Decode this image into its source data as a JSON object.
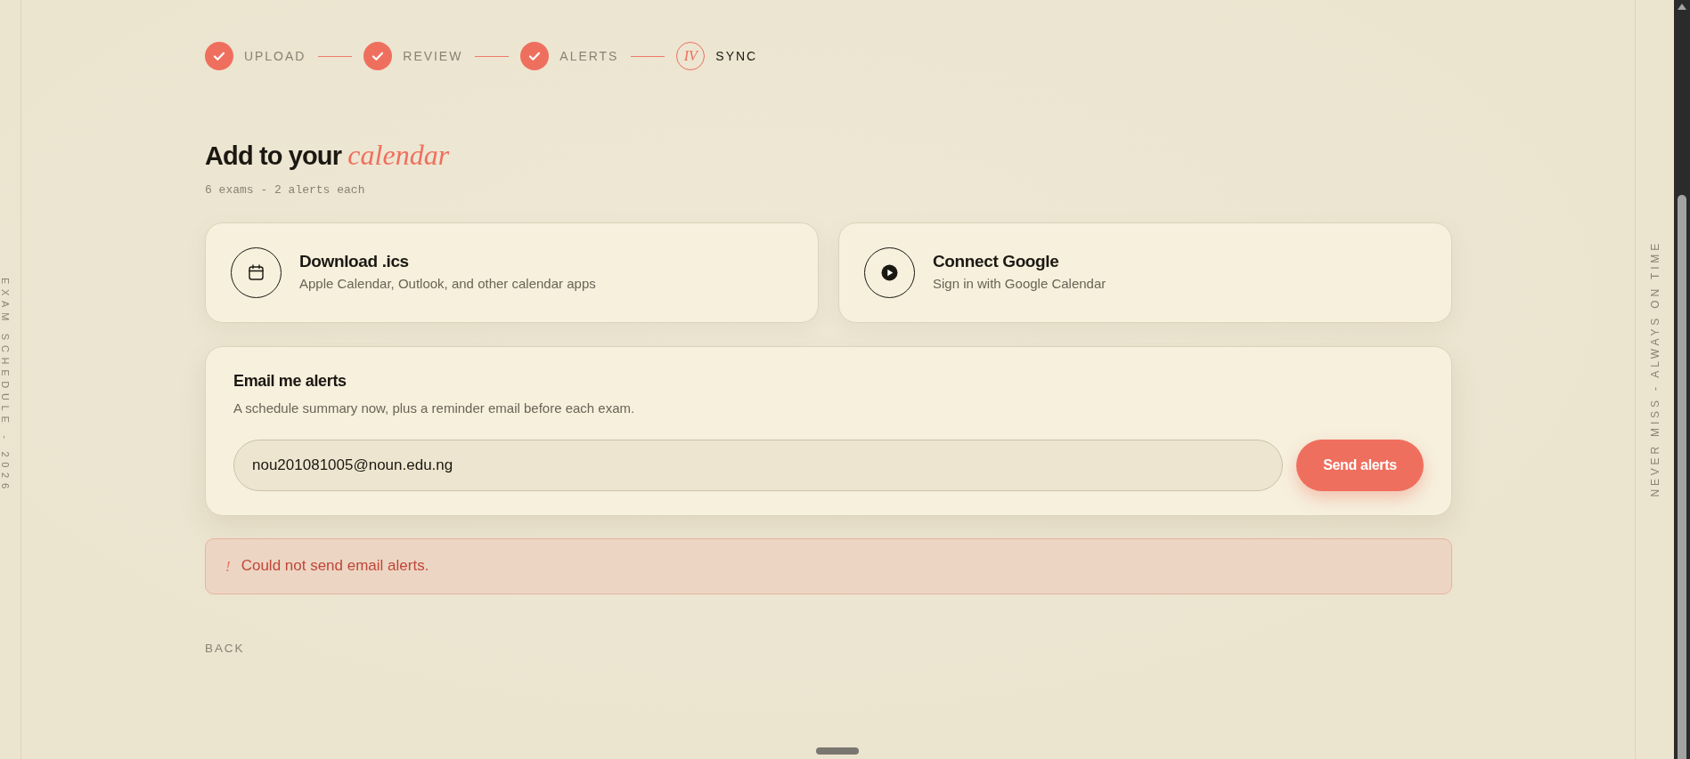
{
  "rails": {
    "left": "EXAM SCHEDULE - 2026",
    "right": "NEVER MISS - ALWAYS ON TIME"
  },
  "steps": [
    {
      "label": "UPLOAD",
      "completed": true,
      "selected": false
    },
    {
      "label": "REVIEW",
      "completed": true,
      "selected": false
    },
    {
      "label": "ALERTS",
      "completed": true,
      "selected": false
    },
    {
      "numeral": "IV",
      "label": "SYNC",
      "completed": false,
      "selected": true
    }
  ],
  "heading": "Add to your *calendar*",
  "subtitle": "6 exams - 2 alerts each",
  "options": [
    {
      "kind": "download",
      "title": "Download .ics",
      "description": "Apple Calendar, Outlook, and other calendar apps"
    },
    {
      "kind": "connect",
      "title": "Connect Google",
      "description": "Sign in with Google Calendar"
    }
  ],
  "email_alerts": {
    "title": "Email me alerts",
    "description": "A schedule summary now, plus a reminder email before each exam.",
    "email": "nou201081005@noun.edu.ng",
    "button": "Send alerts"
  },
  "error": {
    "mark": "!",
    "message": "Could not send email alerts."
  },
  "back": "BACK"
}
